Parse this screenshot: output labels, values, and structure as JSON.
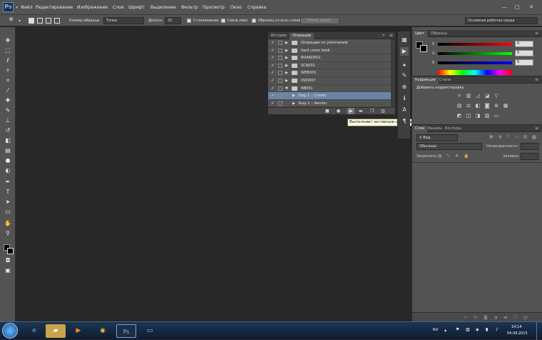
{
  "app": {
    "logo": "Ps"
  },
  "menu": [
    "Файл",
    "Редактирование",
    "Изображение",
    "Слои",
    "Шрифт",
    "Выделение",
    "Фильтр",
    "Просмотр",
    "Окно",
    "Справка"
  ],
  "window_controls": [
    "—",
    "□",
    "✕"
  ],
  "options_bar": {
    "sample_size_label": "Размер образца:",
    "sample_size_value": "Точка",
    "tolerance_label": "Допуск:",
    "tolerance_value": "32",
    "antialias_label": "Сглаживание",
    "contiguous_label": "Смеж.пикс",
    "all_layers_label": "Образец со всех слоев",
    "refine_edge_label": "Уточн. край...",
    "workspace": "Основная рабочая среда"
  },
  "tools": [
    "selection-move-icon",
    "marquee-icon",
    "lasso-icon",
    "quick-select-icon",
    "crop-icon",
    "eyedropper-icon",
    "healing-icon",
    "brush-icon",
    "stamp-icon",
    "history-brush-icon",
    "eraser-icon",
    "gradient-icon",
    "blur-icon",
    "dodge-icon",
    "pen-icon",
    "type-icon",
    "path-select-icon",
    "shape-icon",
    "hand-icon",
    "zoom-icon"
  ],
  "actions_panel": {
    "tabs": [
      "История",
      "Операции"
    ],
    "active_tab": "Операции",
    "rows": [
      {
        "label": "Операции по умолчанию",
        "type": "set"
      },
      {
        "label": "hard cover book",
        "type": "set"
      },
      {
        "label": "BOARD002",
        "type": "set"
      },
      {
        "label": "SCN001",
        "type": "set"
      },
      {
        "label": "WEB003",
        "type": "set"
      },
      {
        "label": "DVD007",
        "type": "set"
      },
      {
        "label": "NB001",
        "type": "set-open"
      },
      {
        "label": "Step 1 :: Create",
        "type": "action-selected"
      },
      {
        "label": "Step 2 :: Render",
        "type": "action"
      }
    ]
  },
  "tooltip": "Выполняет активную операцию или команду",
  "color_panel": {
    "tabs": [
      "Цвет",
      "Образцы"
    ],
    "channels": [
      {
        "label": "R",
        "value": "0"
      },
      {
        "label": "G",
        "value": "0"
      },
      {
        "label": "B",
        "value": "0"
      }
    ]
  },
  "adjustments_panel": {
    "tabs": [
      "Коррекция",
      "Стили"
    ],
    "title": "Добавить корректировку"
  },
  "layers_panel": {
    "tabs": [
      "Слои",
      "Каналы",
      "Контуры"
    ],
    "filter": "Вид",
    "blend_mode": "Обычные",
    "opacity_label": "Непрозрачность:",
    "lock_label": "Закрепить:",
    "fill_label": "Заливка:"
  },
  "taskbar": {
    "lang": "RU",
    "time": "14:14",
    "date": "04.09.2015"
  }
}
